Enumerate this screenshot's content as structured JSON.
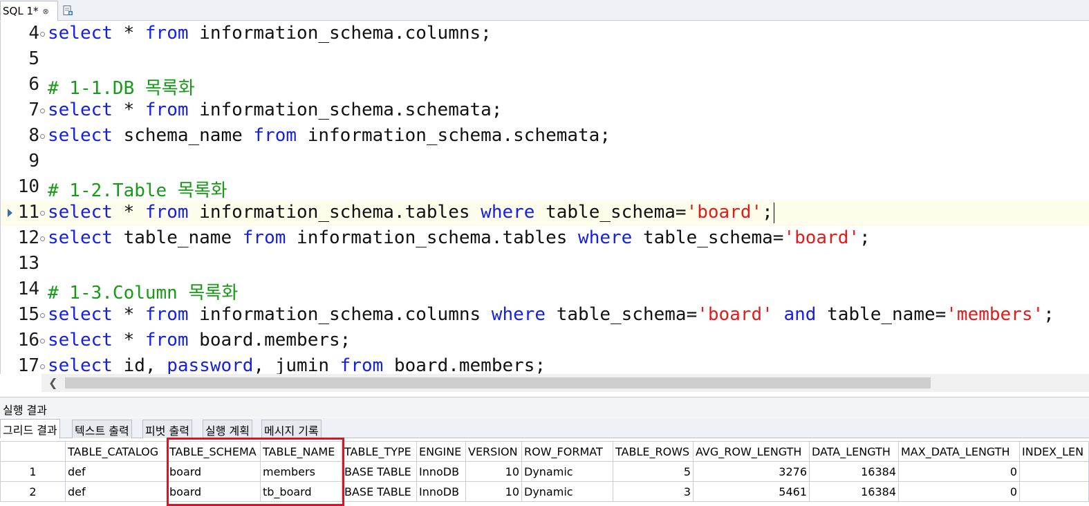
{
  "tabbar": {
    "tab_label": "SQL 1*",
    "close_glyph": "⊗",
    "new_tab_icon": "new-sql-tab-icon"
  },
  "editor": {
    "lines": [
      {
        "num": "4",
        "tokens": [
          [
            "kw",
            "select"
          ],
          [
            "",
            "*"
          ],
          [
            "kw",
            "from"
          ],
          [
            "",
            "information_schema.columns;"
          ]
        ]
      },
      {
        "num": "5",
        "tokens": []
      },
      {
        "num": "6",
        "tokens": [
          [
            "cm",
            "# 1-1.DB 목록화"
          ]
        ]
      },
      {
        "num": "7",
        "tokens": [
          [
            "kw",
            "select"
          ],
          [
            "",
            "*"
          ],
          [
            "kw",
            "from"
          ],
          [
            "",
            "information_schema.schemata;"
          ]
        ]
      },
      {
        "num": "8",
        "tokens": [
          [
            "kw",
            "select"
          ],
          [
            "",
            "schema_name"
          ],
          [
            "kw",
            "from"
          ],
          [
            "",
            "information_schema.schemata;"
          ]
        ]
      },
      {
        "num": "9",
        "tokens": []
      },
      {
        "num": "10",
        "tokens": [
          [
            "cm",
            "# 1-2.Table 목록화"
          ]
        ]
      },
      {
        "num": "11",
        "tokens": [
          [
            "kw",
            "select"
          ],
          [
            "",
            "*"
          ],
          [
            "kw",
            "from"
          ],
          [
            "",
            "information_schema.tables"
          ],
          [
            "kw",
            "where"
          ],
          [
            "",
            "table_schema="
          ],
          [
            "str",
            "'board'"
          ],
          [
            "",
            ";"
          ]
        ]
      },
      {
        "num": "12",
        "tokens": [
          [
            "kw",
            "select"
          ],
          [
            "",
            "table_name"
          ],
          [
            "kw",
            "from"
          ],
          [
            "",
            "information_schema.tables"
          ],
          [
            "kw",
            "where"
          ],
          [
            "",
            "table_schema="
          ],
          [
            "str",
            "'board'"
          ],
          [
            "",
            ";"
          ]
        ]
      },
      {
        "num": "13",
        "tokens": []
      },
      {
        "num": "14",
        "tokens": [
          [
            "cm",
            "# 1-3.Column 목록화"
          ]
        ]
      },
      {
        "num": "15",
        "tokens": [
          [
            "kw",
            "select"
          ],
          [
            "",
            "*"
          ],
          [
            "kw",
            "from"
          ],
          [
            "",
            "information_schema.columns"
          ],
          [
            "kw",
            "where"
          ],
          [
            "",
            "table_schema="
          ],
          [
            "str",
            "'board'"
          ],
          [
            "kw",
            "and"
          ],
          [
            "",
            "table_name="
          ],
          [
            "str",
            "'members'"
          ],
          [
            "",
            ";"
          ]
        ]
      },
      {
        "num": "16",
        "tokens": [
          [
            "kw",
            "select"
          ],
          [
            "",
            "*"
          ],
          [
            "kw",
            "from"
          ],
          [
            "",
            "board.members;"
          ]
        ]
      },
      {
        "num": "17",
        "tokens": [
          [
            "kw",
            "select"
          ],
          [
            "",
            "id,"
          ],
          [
            "kw",
            "password"
          ],
          [
            "",
            ","
          ],
          [
            "",
            "jumin"
          ],
          [
            "kw",
            "from"
          ],
          [
            "",
            "board.members;"
          ]
        ]
      }
    ],
    "current_line": "11",
    "fold_lines": [
      "4",
      "7",
      "8",
      "11",
      "12",
      "15",
      "16",
      "17"
    ]
  },
  "results": {
    "title": "실행 결과",
    "tabs": [
      "그리드 결과",
      "텍스트 출력",
      "피벗 출력",
      "실행 계획",
      "메시지 기록"
    ],
    "active_tab": 0,
    "columns": [
      "TABLE_CATALOG",
      "TABLE_SCHEMA",
      "TABLE_NAME",
      "TABLE_TYPE",
      "ENGINE",
      "VERSION",
      "ROW_FORMAT",
      "TABLE_ROWS",
      "AVG_ROW_LENGTH",
      "DATA_LENGTH",
      "MAX_DATA_LENGTH",
      "INDEX_LEN"
    ],
    "column_align": [
      "txt",
      "txt",
      "txt",
      "txt",
      "txt",
      "num",
      "txt",
      "num",
      "num",
      "num",
      "num",
      "num"
    ],
    "rows": [
      {
        "rownum": "1",
        "cells": [
          "def",
          "board",
          "members",
          "BASE TABLE",
          "InnoDB",
          "10",
          "Dynamic",
          "5",
          "3276",
          "16384",
          "0",
          ""
        ]
      },
      {
        "rownum": "2",
        "cells": [
          "def",
          "board",
          "tb_board",
          "BASE TABLE",
          "InnoDB",
          "10",
          "Dynamic",
          "3",
          "5461",
          "16384",
          "0",
          ""
        ]
      }
    ],
    "highlight_color": "#e0121d"
  }
}
